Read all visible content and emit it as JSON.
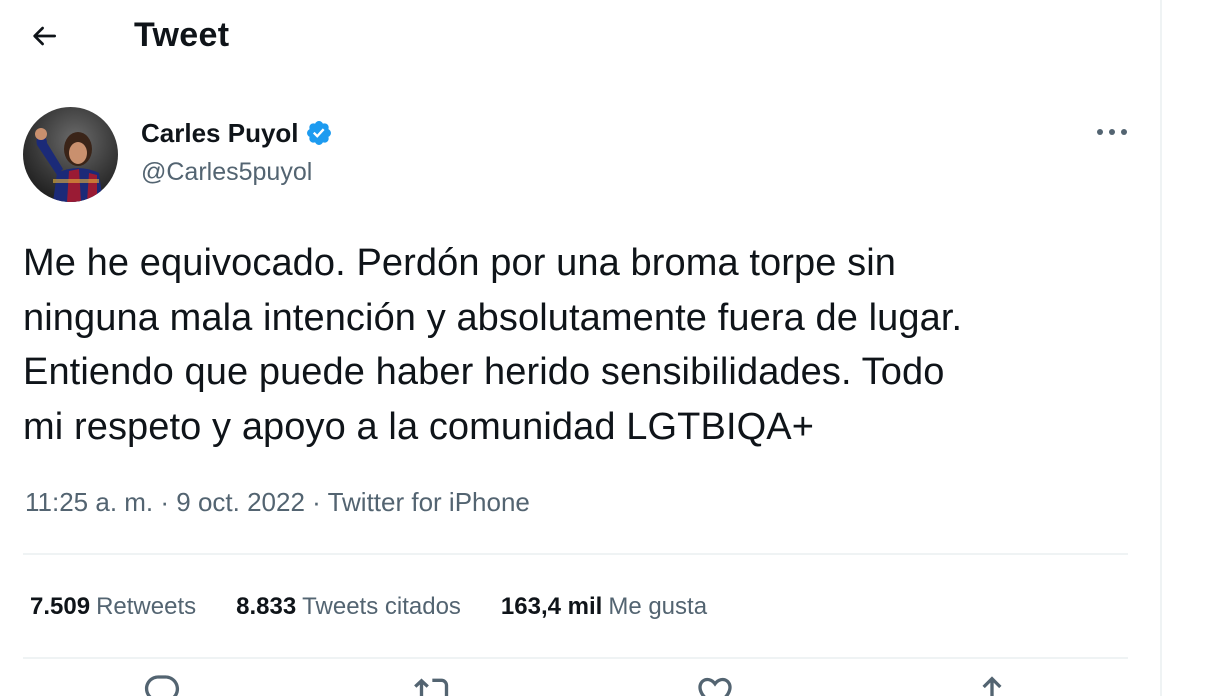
{
  "header": {
    "title": "Tweet",
    "back_icon": "arrow-left-icon"
  },
  "tweet": {
    "author": {
      "name": "Carles Puyol",
      "handle": "@Carles5puyol",
      "verified_icon": "verified-badge-icon",
      "verified_color": "#1d9bf0"
    },
    "text": "Me he equivocado. Perdón por una broma torpe sin\nninguna mala intención y absolutamente fuera de lugar.\nEntiendo que puede haber herido sensibilidades. Todo\nmi respeto y apoyo a la comunidad LGTBIQA+",
    "time": "11:25 a. m.",
    "separator": " · ",
    "date": "9 oct. 2022",
    "source": "Twitter for iPhone"
  },
  "stats": {
    "retweets": {
      "count": "7.509",
      "label": "Retweets"
    },
    "quotes": {
      "count": "8.833",
      "label": "Tweets citados"
    },
    "likes": {
      "count": "163,4 mil",
      "label": "Me gusta"
    }
  },
  "actions": [
    {
      "icon": "reply-icon"
    },
    {
      "icon": "retweet-icon"
    },
    {
      "icon": "heart-icon"
    },
    {
      "icon": "share-icon"
    }
  ],
  "colors": {
    "text_primary": "#0f1419",
    "text_secondary": "#536471",
    "divider": "#eff3f4",
    "accent": "#1d9bf0"
  }
}
